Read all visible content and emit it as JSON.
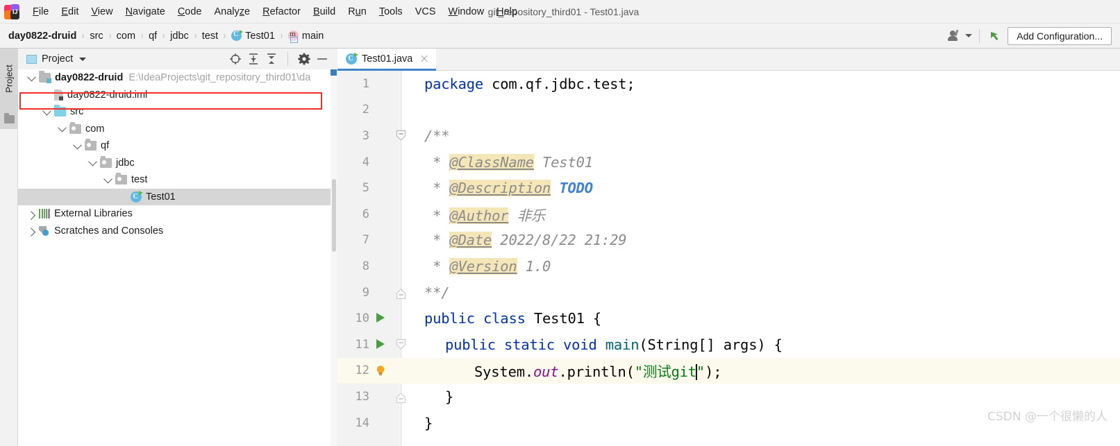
{
  "window": {
    "title": "git_repository_third01 - Test01.java",
    "logo_icon": "intellij-idea-logo"
  },
  "menubar": {
    "items": [
      {
        "label": "File",
        "mnemonic": "F"
      },
      {
        "label": "Edit",
        "mnemonic": "E"
      },
      {
        "label": "View",
        "mnemonic": "V"
      },
      {
        "label": "Navigate",
        "mnemonic": "N"
      },
      {
        "label": "Code",
        "mnemonic": "C"
      },
      {
        "label": "Analyze",
        "mnemonic": "z"
      },
      {
        "label": "Refactor",
        "mnemonic": "R"
      },
      {
        "label": "Build",
        "mnemonic": "B"
      },
      {
        "label": "Run",
        "mnemonic": "u"
      },
      {
        "label": "Tools",
        "mnemonic": "T"
      },
      {
        "label": "VCS",
        "mnemonic": ""
      },
      {
        "label": "Window",
        "mnemonic": "W"
      },
      {
        "label": "Help",
        "mnemonic": "H"
      }
    ]
  },
  "navbar": {
    "breadcrumbs": [
      {
        "label": "day0822-druid",
        "icon": "",
        "bold": true
      },
      {
        "label": "src",
        "icon": ""
      },
      {
        "label": "com",
        "icon": ""
      },
      {
        "label": "qf",
        "icon": ""
      },
      {
        "label": "jdbc",
        "icon": ""
      },
      {
        "label": "test",
        "icon": ""
      },
      {
        "label": "Test01",
        "icon": "java-class-icon"
      },
      {
        "label": "main",
        "icon": "java-method-icon"
      }
    ],
    "separator": "›",
    "user_icon": "user-settings-icon",
    "vcs_icon": "vcs-update-icon",
    "add_configuration_label": "Add Configuration..."
  },
  "left_strip": {
    "tab_label": "Project",
    "folder_icon": "folder-icon"
  },
  "project_panel": {
    "header_title": "Project",
    "header_icon": "project-view-icon",
    "tools": [
      {
        "name": "locate-icon",
        "title": "Select Opened File"
      },
      {
        "name": "expand-all-icon",
        "title": "Expand All"
      },
      {
        "name": "collapse-all-icon",
        "title": "Collapse All"
      },
      {
        "name": "gear-icon",
        "title": "Settings"
      },
      {
        "name": "minimize-icon",
        "title": "Hide"
      }
    ],
    "tree": [
      {
        "label": "day0822-druid",
        "secondary": "E:\\IdeaProjects\\git_repository_third01\\da",
        "indent": 0,
        "twisty": "down",
        "icon": "project-folder-icon",
        "bold": true,
        "selected": false,
        "highlighted": true
      },
      {
        "label": "day0822-druid.iml",
        "secondary": "",
        "indent": 1,
        "twisty": "none",
        "icon": "iml-file-icon",
        "bold": false,
        "selected": false,
        "highlighted": false
      },
      {
        "label": "src",
        "secondary": "",
        "indent": 1,
        "twisty": "down",
        "icon": "source-folder-icon",
        "bold": false,
        "selected": false,
        "highlighted": false
      },
      {
        "label": "com",
        "secondary": "",
        "indent": 2,
        "twisty": "down",
        "icon": "package-icon",
        "bold": false,
        "selected": false,
        "highlighted": false
      },
      {
        "label": "qf",
        "secondary": "",
        "indent": 3,
        "twisty": "down",
        "icon": "package-icon",
        "bold": false,
        "selected": false,
        "highlighted": false
      },
      {
        "label": "jdbc",
        "secondary": "",
        "indent": 4,
        "twisty": "down",
        "icon": "package-icon",
        "bold": false,
        "selected": false,
        "highlighted": false
      },
      {
        "label": "test",
        "secondary": "",
        "indent": 5,
        "twisty": "down",
        "icon": "package-icon",
        "bold": false,
        "selected": false,
        "highlighted": false
      },
      {
        "label": "Test01",
        "secondary": "",
        "indent": 6,
        "twisty": "none",
        "icon": "java-class-icon",
        "bold": false,
        "selected": true,
        "highlighted": false
      },
      {
        "label": "External Libraries",
        "secondary": "",
        "indent": 0,
        "twisty": "right",
        "icon": "libraries-icon",
        "bold": false,
        "selected": false,
        "highlighted": false
      },
      {
        "label": "Scratches and Consoles",
        "secondary": "",
        "indent": 0,
        "twisty": "right",
        "icon": "scratches-icon",
        "bold": false,
        "selected": false,
        "highlighted": false
      }
    ]
  },
  "editor": {
    "tab": {
      "label": "Test01.java",
      "icon": "java-class-icon",
      "close_icon": "close-icon"
    },
    "current_line": 12,
    "lines": [
      {
        "n": 1,
        "gutter": "",
        "fold": false
      },
      {
        "n": 2,
        "gutter": "",
        "fold": false
      },
      {
        "n": 3,
        "gutter": "",
        "fold": true
      },
      {
        "n": 4,
        "gutter": "",
        "fold": false
      },
      {
        "n": 5,
        "gutter": "",
        "fold": false
      },
      {
        "n": 6,
        "gutter": "",
        "fold": false
      },
      {
        "n": 7,
        "gutter": "",
        "fold": false
      },
      {
        "n": 8,
        "gutter": "",
        "fold": false
      },
      {
        "n": 9,
        "gutter": "",
        "fold": true
      },
      {
        "n": 10,
        "gutter": "run-arrow-icon",
        "fold": false
      },
      {
        "n": 11,
        "gutter": "run-arrow-icon",
        "fold": true
      },
      {
        "n": 12,
        "gutter": "lightbulb-icon",
        "fold": false
      },
      {
        "n": 13,
        "gutter": "",
        "fold": true
      },
      {
        "n": 14,
        "gutter": "",
        "fold": false
      }
    ],
    "code": {
      "l1_kw": "package",
      "l1_rest": " com.qf.jdbc.test;",
      "l3": "/**",
      "l4_star": " * ",
      "l4_tag": "@ClassName",
      "l4_val": " Test01",
      "l5_star": " * ",
      "l5_tag": "@Description",
      "l5_val": "TODO",
      "l6_star": " * ",
      "l6_tag": "@Author",
      "l6_val": " 非乐",
      "l7_star": " * ",
      "l7_tag": "@Date",
      "l7_val": " 2022/8/22 21:29",
      "l8_star": " * ",
      "l8_tag": "@Version",
      "l8_val": " 1.0",
      "l9": "**/",
      "l10_kw1": "public",
      "l10_kw2": "class",
      "l10_name": "Test01 {",
      "l11_kw1": "public",
      "l11_kw2": "static",
      "l11_kw3": "void",
      "l11_mth": "main",
      "l11_rest": "(String[] args) {",
      "l12_sys": "System.",
      "l12_out": "out",
      "l12_dot": ".",
      "l12_println": "println",
      "l12_paren": "(",
      "l12_str": "\"测试git",
      "l12_strend": "\"",
      "l12_tail": ");",
      "l13": "}",
      "l14": "}"
    }
  },
  "watermark": {
    "text": "CSDN @一个很懒的人"
  },
  "colors": {
    "accent_blue": "#4083c9",
    "keyword_blue": "#0033b3",
    "string_green": "#067d17",
    "highlight_red": "#ee3124",
    "javadoc_tag_bg": "#f5e6b8",
    "current_line_bg": "#fcfaec",
    "selection_grey": "#d6d6d6"
  }
}
